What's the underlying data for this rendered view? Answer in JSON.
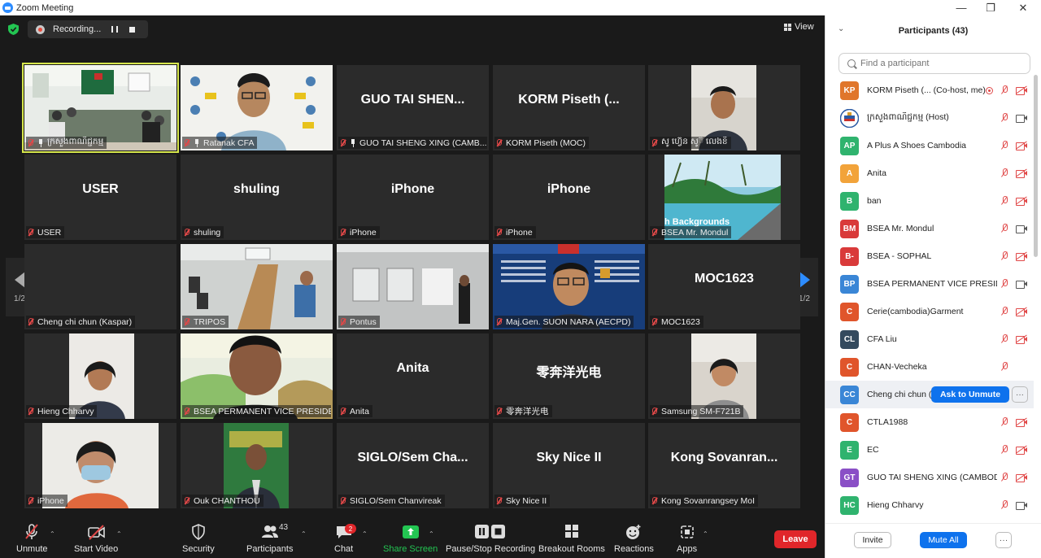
{
  "window": {
    "title": "Zoom Meeting",
    "controls": [
      "minimize",
      "maximize",
      "close"
    ]
  },
  "recording": {
    "label": "Recording..."
  },
  "view_label": "View",
  "pagination": {
    "left": "1/2",
    "right": "1/2"
  },
  "tiles": [
    {
      "name": "ក្រសួងពាណិជ្ជកម្ម",
      "big": "",
      "video": "meeting-room",
      "pinned": true,
      "active": true
    },
    {
      "name": "Ratanak CFA",
      "big": "",
      "video": "man-glasses-banner",
      "pinned": true
    },
    {
      "name": "GUO TAI SHENG XING (CAMB...",
      "big": "GUO TAI SHEN...",
      "pinned": true
    },
    {
      "name": "KORM Piseth (MOC)",
      "big": "KORM  Piseth  (..."
    },
    {
      "name": "សូ ហ៊្វេន សូ៊ លេងខិ",
      "big": "",
      "video": "man-office"
    },
    {
      "name": "USER",
      "big": "USER"
    },
    {
      "name": "shuling",
      "big": "shuling"
    },
    {
      "name": "iPhone",
      "big": "iPhone"
    },
    {
      "name": "iPhone",
      "big": "iPhone"
    },
    {
      "name": "BSEA  Mr. Mondul",
      "big": "",
      "video": "beach-background",
      "bg_text": "h Backgrounds"
    },
    {
      "name": "Cheng chi chun (Kaspar)",
      "big": ""
    },
    {
      "name": "TRIPOS",
      "big": "",
      "video": "conference-room"
    },
    {
      "name": "Pontus",
      "big": "",
      "video": "office-wall"
    },
    {
      "name": "Maj.Gen. SUON NARA (AECPD)",
      "big": "",
      "video": "blue-banner"
    },
    {
      "name": "MOC1623",
      "big": "MOC1623"
    },
    {
      "name": "Hieng Chharvy",
      "big": "",
      "video": "woman-white-wall"
    },
    {
      "name": "BSEA PERMANENT VICE PRESIDE...",
      "big": "",
      "video": "man-closeup"
    },
    {
      "name": "Anita",
      "big": "Anita"
    },
    {
      "name": "零奔洋光电",
      "big": "零奔洋光电"
    },
    {
      "name": "Samsung SM-F721B",
      "big": "",
      "video": "woman-room"
    },
    {
      "name": "iPhone",
      "big": "",
      "video": "woman-mask"
    },
    {
      "name": "Ouk CHANTHOU",
      "big": "",
      "video": "man-green-bg"
    },
    {
      "name": "SIGLO/Sem Chanvireak",
      "big": "SIGLO/Sem  Cha..."
    },
    {
      "name": "Sky Nice II",
      "big": "Sky Nice II"
    },
    {
      "name": "Kong Sovanrangsey MoI",
      "big": "Kong  Sovanran..."
    }
  ],
  "toolbar": {
    "unmute": "Unmute",
    "start_video": "Start Video",
    "security": "Security",
    "participants": "Participants",
    "participants_count": "43",
    "chat": "Chat",
    "chat_badge": "2",
    "share_screen": "Share Screen",
    "recording": "Pause/Stop Recording",
    "breakout": "Breakout Rooms",
    "reactions": "Reactions",
    "apps": "Apps",
    "leave": "Leave"
  },
  "panel": {
    "title": "Participants (43)",
    "search_placeholder": "Find a participant",
    "participants": [
      {
        "initials": "KP",
        "color": "#e0762b",
        "name": "KORM Piseth (... (Co-host, me)",
        "rec": true,
        "video": "off"
      },
      {
        "initials": "",
        "color": "#ffffff",
        "name": "ក្រសួងពាណិជ្ជកម្ម (Host)",
        "logo": true,
        "video": "on"
      },
      {
        "initials": "AP",
        "color": "#2fb36e",
        "name": "A Plus A Shoes Cambodia",
        "video": "off"
      },
      {
        "initials": "A",
        "color": "#f2a33a",
        "name": "Anita",
        "video": "off"
      },
      {
        "initials": "B",
        "color": "#2fb36e",
        "name": "ban",
        "video": "off"
      },
      {
        "initials": "BM",
        "color": "#d93a3a",
        "name": "BSEA  Mr. Mondul",
        "video": "on"
      },
      {
        "initials": "B-",
        "color": "#d93a3a",
        "name": "BSEA - SOPHAL",
        "video": "off"
      },
      {
        "initials": "BP",
        "color": "#3a86d6",
        "name": "BSEA PERMANENT VICE PRESIDE...",
        "video": "on"
      },
      {
        "initials": "C",
        "color": "#e0552b",
        "name": "Cerie(cambodia)Garment",
        "video": "off"
      },
      {
        "initials": "CL",
        "color": "#344a5e",
        "name": "CFA Liu",
        "video": "off"
      },
      {
        "initials": "C",
        "color": "#e0552b",
        "name": "CHAN-Vecheka",
        "video": "none"
      },
      {
        "initials": "CC",
        "color": "#3a86d6",
        "name": "Cheng chi chun (",
        "video": "ask",
        "highlight": true
      },
      {
        "initials": "C",
        "color": "#e0552b",
        "name": "CTLA1988",
        "video": "off"
      },
      {
        "initials": "E",
        "color": "#2fb36e",
        "name": "EC",
        "video": "off"
      },
      {
        "initials": "GT",
        "color": "#8a4fc6",
        "name": "GUO TAI SHENG XING (CAMBOD...",
        "video": "off"
      },
      {
        "initials": "HC",
        "color": "#2fb36e",
        "name": "Hieng Chharvy",
        "video": "on"
      }
    ],
    "ask_to_unmute": "Ask to Unmute",
    "footer": {
      "invite": "Invite",
      "mute_all": "Mute All",
      "more": "···"
    }
  }
}
